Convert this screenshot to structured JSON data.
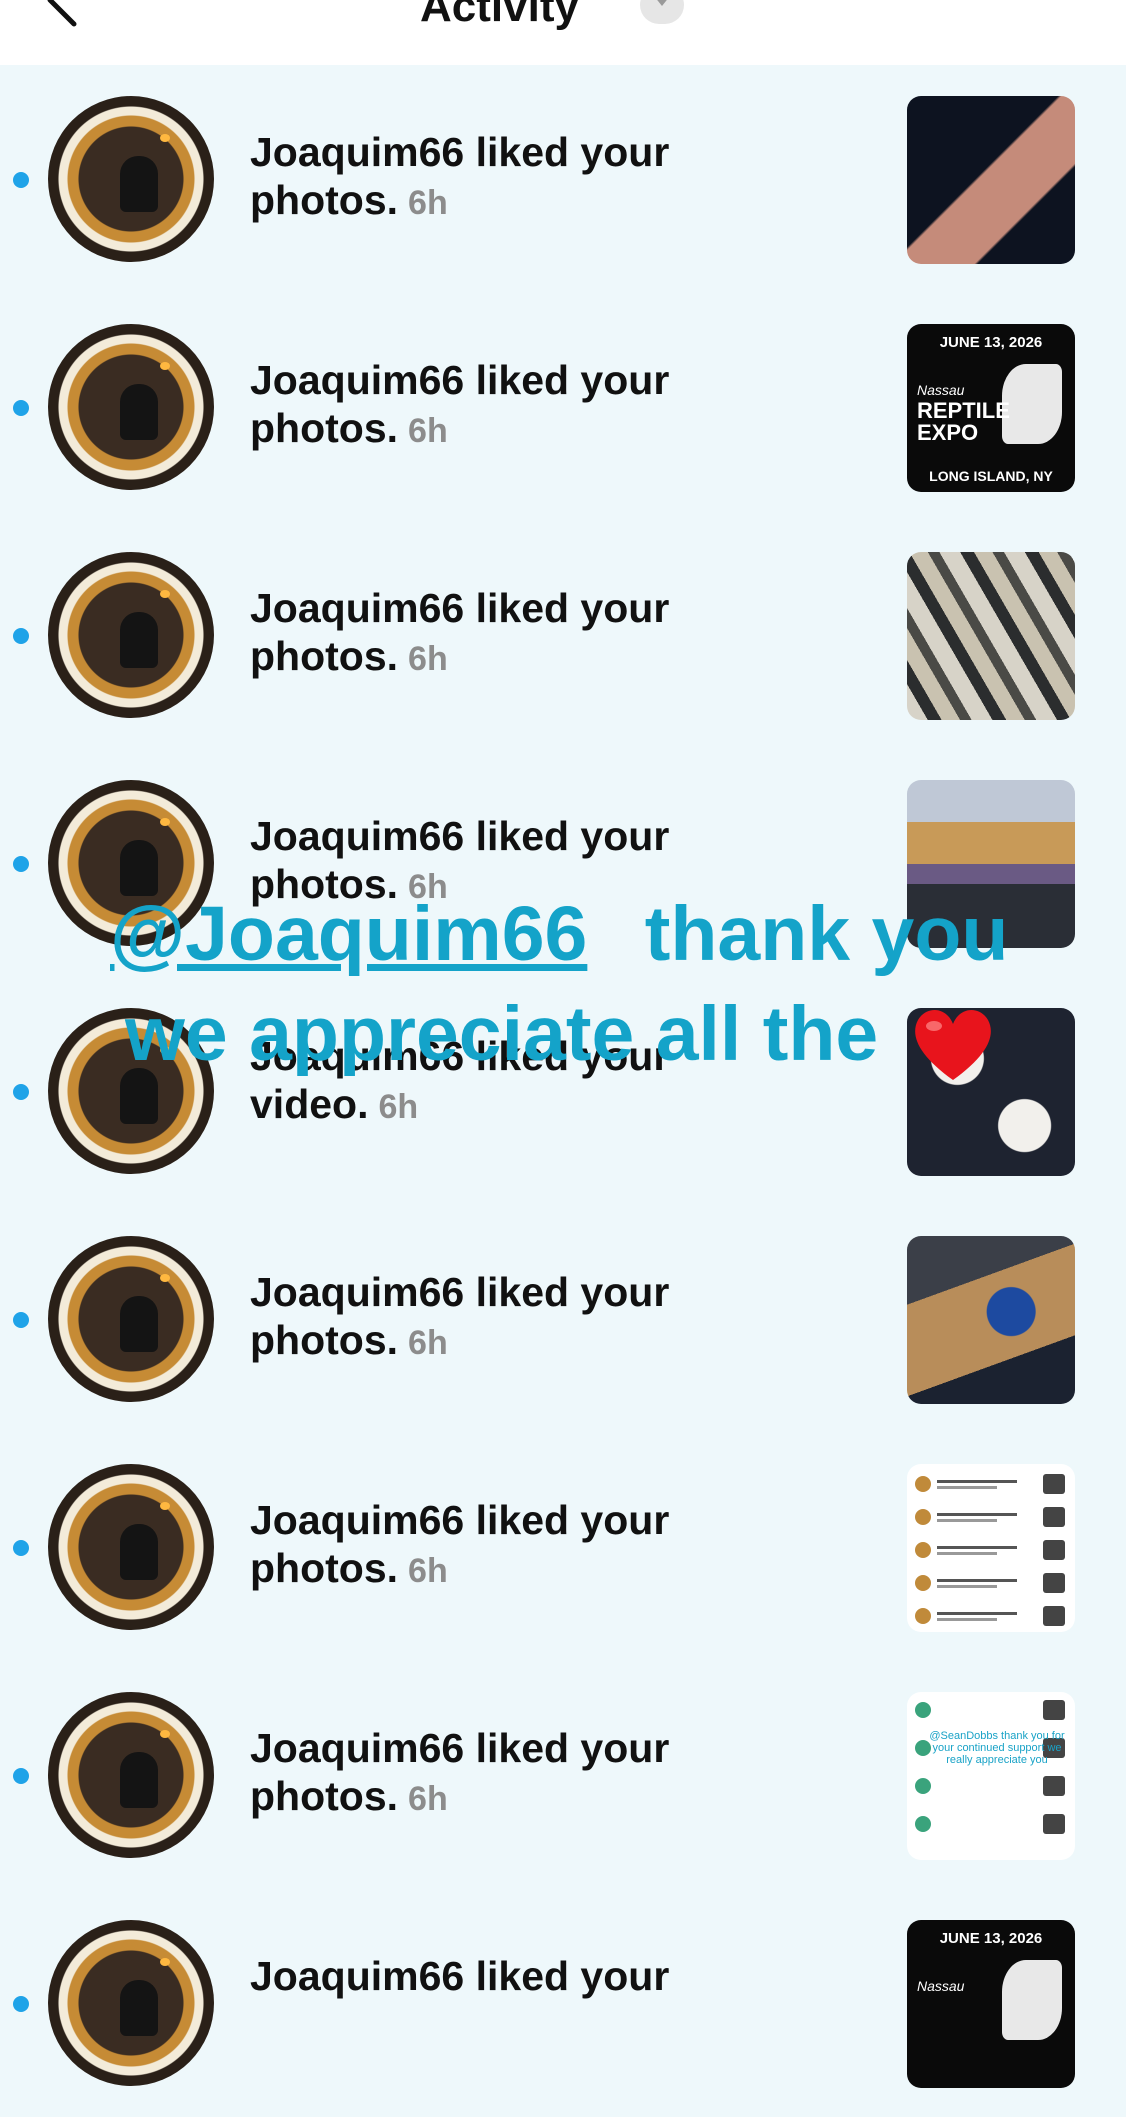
{
  "header": {
    "title": "Activity"
  },
  "notifications": [
    {
      "user": "Joaquim66",
      "action": "liked your photos.",
      "time": "6h",
      "thumb": "hands"
    },
    {
      "user": "Joaquim66",
      "action": "liked your photos.",
      "time": "6h",
      "thumb": "expo",
      "thumb_text": {
        "date": "JUNE 13, 2026",
        "name": "Nassau",
        "title": "REPTILE EXPO",
        "location": "LONG ISLAND, NY"
      }
    },
    {
      "user": "Joaquim66",
      "action": "liked your photos.",
      "time": "6h",
      "thumb": "python"
    },
    {
      "user": "Joaquim66",
      "action": "liked your photos.",
      "time": "6h",
      "thumb": "table"
    },
    {
      "user": "Joaquim66",
      "action": "liked your video.",
      "time": "6h",
      "thumb": "eggs"
    },
    {
      "user": "Joaquim66",
      "action": "liked your photos.",
      "time": "6h",
      "thumb": "tub"
    },
    {
      "user": "Joaquim66",
      "action": "liked your photos.",
      "time": "6h",
      "thumb": "list"
    },
    {
      "user": "Joaquim66",
      "action": "liked your photos.",
      "time": "6h",
      "thumb": "comments"
    },
    {
      "user": "Joaquim66",
      "action": "liked your",
      "time": "",
      "thumb": "expo",
      "thumb_text": {
        "date": "JUNE 13, 2026",
        "name": "Nassau",
        "title": "",
        "location": ""
      }
    }
  ],
  "overlay": {
    "mention": "@Joaquim66",
    "line1_rest": "thank you",
    "line2": "we appreciate all the",
    "heart_icon": "red-heart-emoji",
    "color": "#14a3c9"
  },
  "thumb_comments_caption": "@SeanDobbs thank you for your continued support we really appreciate you",
  "colors": {
    "unread_dot": "#1fa3e8",
    "background": "#eef8fb",
    "time": "#8c8c8c"
  }
}
